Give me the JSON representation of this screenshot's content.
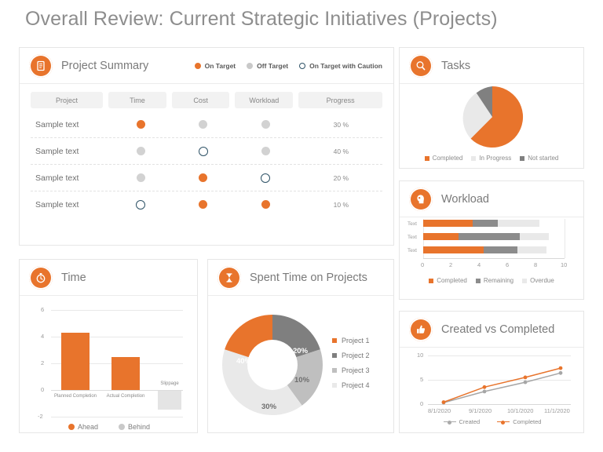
{
  "page": {
    "title": "Overall Review: Current Strategic Initiatives (Projects)"
  },
  "colors": {
    "orange": "#E8742C",
    "gray_dark": "#7F7F7F",
    "gray_mid": "#BFBFBF",
    "gray_light": "#E9E9E9",
    "caution_ring": "#2E5266",
    "off_target": "#D2D2D2"
  },
  "project_summary": {
    "icon": "document-icon",
    "title": "Project Summary",
    "legend": [
      {
        "label": "On Target",
        "marker": "filled-orange-dot"
      },
      {
        "label": "Off Target",
        "marker": "filled-gray-dot"
      },
      {
        "label": "On Target  with Caution",
        "marker": "outlined-blue-circle"
      }
    ],
    "columns": [
      "Project",
      "Time",
      "Cost",
      "Workload",
      "Progress"
    ],
    "rows": [
      {
        "project": "Sample text",
        "time": "on",
        "cost": "off",
        "workload": "off",
        "progress": "30 %"
      },
      {
        "project": "Sample text",
        "time": "off",
        "cost": "caution",
        "workload": "off",
        "progress": "40 %"
      },
      {
        "project": "Sample text",
        "time": "off",
        "cost": "on",
        "workload": "caution",
        "progress": "20 %"
      },
      {
        "project": "Sample text",
        "time": "caution",
        "cost": "on",
        "workload": "on",
        "progress": "10 %"
      }
    ]
  },
  "tasks": {
    "icon": "search-icon",
    "title": "Tasks",
    "chart_data": {
      "type": "pie",
      "title": "Tasks",
      "categories": [
        "Completed",
        "In Progress",
        "Not started"
      ],
      "values": [
        62,
        28,
        10
      ],
      "colors": [
        "#E8742C",
        "#E9E9E9",
        "#808080"
      ],
      "legend_position": "bottom",
      "grid": false
    }
  },
  "workload": {
    "icon": "head-profile-icon",
    "title": "Workload",
    "chart_data": {
      "type": "bar",
      "orientation": "horizontal",
      "stacked": true,
      "title": "Workload",
      "categories": [
        "Text",
        "Text",
        "Text"
      ],
      "series": [
        {
          "name": "Completed",
          "values": [
            3.5,
            2.5,
            4.25
          ],
          "color": "#E8742C"
        },
        {
          "name": "Remaining",
          "values": [
            1.8,
            4.35,
            2.4
          ],
          "color": "#8C8C8C"
        },
        {
          "name": "Overdue",
          "values": [
            2.9,
            2.05,
            2.05
          ],
          "color": "#E9E9E9"
        }
      ],
      "xticks": [
        "0",
        "2",
        "4",
        "6",
        "8",
        "10"
      ],
      "xlim": [
        0,
        10
      ],
      "legend_position": "bottom",
      "grid": false
    }
  },
  "time": {
    "icon": "stopwatch-icon",
    "title": "Time",
    "chart_data": {
      "type": "bar",
      "title": "Time",
      "categories": [
        "Planned Completion",
        "Actual Completion",
        "Slippage"
      ],
      "values": [
        4.3,
        2.5,
        -1.4
      ],
      "colors": [
        "#E8742C",
        "#E8742C",
        "#E4E4E4"
      ],
      "yticks": [
        "6",
        "4",
        "2",
        "0",
        "-2"
      ],
      "ylim": [
        -2,
        6
      ],
      "legend": [
        "Ahead",
        "Behind"
      ],
      "legend_colors": [
        "#E8742C",
        "#D2D2D2"
      ],
      "legend_position": "bottom",
      "grid": true
    }
  },
  "spent_time": {
    "icon": "hourglass-icon",
    "title": "Spent Time on Projects",
    "chart_data": {
      "type": "pie",
      "variant": "donut",
      "title": "Spent Time on Projects",
      "categories": [
        "Project 1",
        "Project 2",
        "Project 3",
        "Project 4"
      ],
      "values": [
        40,
        20,
        10,
        30
      ],
      "labels": [
        "40%",
        "20%",
        "10%",
        "30%"
      ],
      "colors": [
        "#E8742C",
        "#7F7F7F",
        "#BFBFBF",
        "#E9E9E9"
      ],
      "legend_position": "right",
      "grid": false
    }
  },
  "created_vs_completed": {
    "icon": "thumbs-up-icon",
    "title": "Created vs Completed",
    "chart_data": {
      "type": "line",
      "title": "Created vs Completed",
      "x": [
        "8/1/2020",
        "9/1/2020",
        "10/1/2020",
        "11/1/2020"
      ],
      "series": [
        {
          "name": "Created",
          "values": [
            0.3,
            2.6,
            4.5,
            6.4
          ],
          "color": "#A6A6A6"
        },
        {
          "name": "Completed",
          "values": [
            0.4,
            3.5,
            5.5,
            7.4
          ],
          "color": "#E8742C"
        }
      ],
      "yticks": [
        "10",
        "5",
        "0"
      ],
      "ylim": [
        0,
        10
      ],
      "legend_position": "bottom",
      "grid": true
    }
  }
}
